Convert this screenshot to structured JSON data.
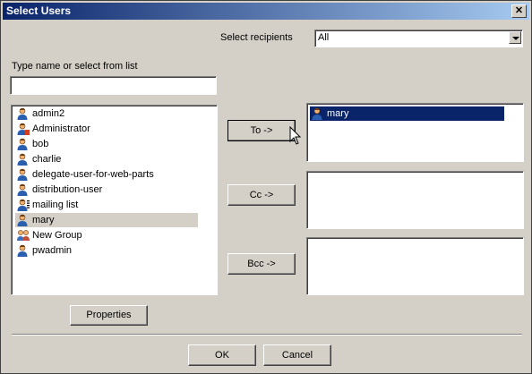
{
  "window": {
    "title": "Select Users"
  },
  "recipients_filter": {
    "label": "Select recipients",
    "value": "All"
  },
  "search": {
    "label": "Type name or select from list",
    "value": ""
  },
  "users": [
    {
      "name": "admin2",
      "icon": "user-icon"
    },
    {
      "name": "Administrator",
      "icon": "admin-user-icon"
    },
    {
      "name": "bob",
      "icon": "user-icon"
    },
    {
      "name": "charlie",
      "icon": "user-icon"
    },
    {
      "name": "delegate-user-for-web-parts",
      "icon": "user-icon"
    },
    {
      "name": "distribution-user",
      "icon": "user-icon"
    },
    {
      "name": "mailing list",
      "icon": "mailing-list-icon"
    },
    {
      "name": "mary",
      "icon": "user-icon",
      "selected": true
    },
    {
      "name": "New Group",
      "icon": "group-icon"
    },
    {
      "name": "pwadmin",
      "icon": "user-icon"
    }
  ],
  "buttons": {
    "to": "To ->",
    "cc": "Cc ->",
    "bcc": "Bcc ->",
    "properties": "Properties",
    "ok": "OK",
    "cancel": "Cancel"
  },
  "to_list": [
    {
      "name": "mary",
      "icon": "user-icon"
    }
  ],
  "cc_list": [],
  "bcc_list": [],
  "colors": {
    "titlebar_start": "#0a246a",
    "titlebar_end": "#a6caf0",
    "selection": "#0a246a",
    "face": "#d4d0c8"
  }
}
